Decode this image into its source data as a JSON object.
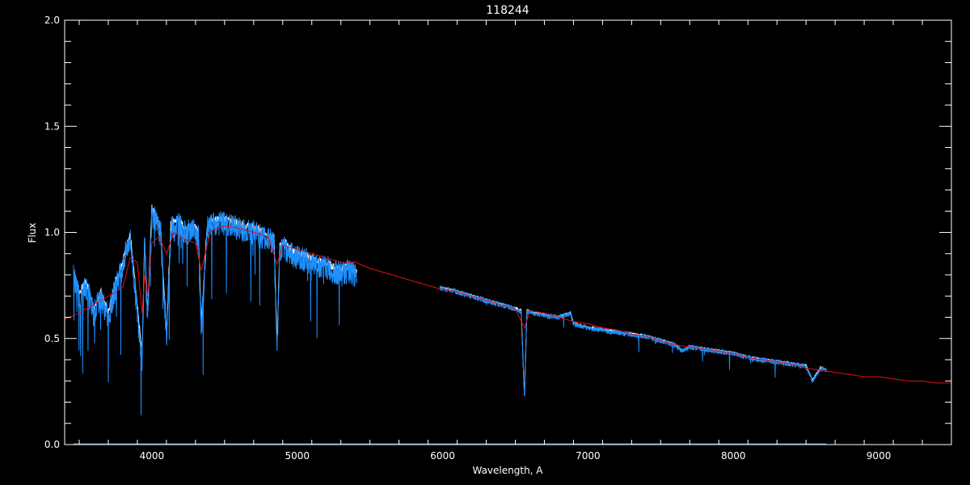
{
  "chart_data": {
    "type": "line",
    "title": "118244",
    "xlabel": "Wavelength, A",
    "ylabel": "Flux",
    "xlim": [
      3400,
      9500
    ],
    "ylim": [
      0.0,
      2.0
    ],
    "x_ticks": [
      4000,
      5000,
      6000,
      7000,
      8000,
      9000
    ],
    "x_tick_labels": [
      "4000",
      "5000",
      "6000",
      "7000",
      "8000",
      "9000"
    ],
    "y_ticks": [
      0.0,
      0.5,
      1.0,
      1.5,
      2.0
    ],
    "y_tick_labels": [
      "0.0",
      "0.5",
      "1.0",
      "1.5",
      "2.0"
    ],
    "grid": false,
    "colors": {
      "background": "#000000",
      "axes": "#ffffff",
      "observed": "#1e90ff",
      "observed_alt": "#ffffff",
      "model": "#e01010"
    },
    "series": [
      {
        "color": "#e01010",
        "x": [
          3400,
          3500,
          3600,
          3700,
          3800,
          3850,
          3900,
          3933,
          3950,
          3970,
          4000,
          4050,
          4101,
          4150,
          4200,
          4250,
          4300,
          4340,
          4400,
          4450,
          4500,
          4600,
          4700,
          4800,
          4861,
          4900,
          5000,
          5100,
          5200,
          5300,
          5400,
          5500,
          5600,
          5700,
          5800,
          5900,
          6000,
          6100,
          6200,
          6300,
          6400,
          6500,
          6563,
          6600,
          6700,
          6800,
          6900,
          7000,
          7100,
          7200,
          7300,
          7400,
          7500,
          7600,
          7700,
          7800,
          7900,
          8000,
          8100,
          8200,
          8300,
          8400,
          8500,
          8600,
          8700,
          8800,
          8900,
          9000,
          9100,
          9200,
          9300,
          9400,
          9500
        ],
        "y": [
          0.59,
          0.62,
          0.66,
          0.7,
          0.74,
          0.88,
          0.86,
          0.62,
          0.8,
          0.7,
          0.95,
          0.98,
          0.9,
          1.0,
          0.98,
          0.96,
          0.95,
          0.82,
          1.0,
          1.02,
          1.03,
          1.02,
          1.0,
          0.98,
          0.85,
          0.94,
          0.92,
          0.9,
          0.88,
          0.86,
          0.86,
          0.83,
          0.81,
          0.79,
          0.77,
          0.75,
          0.73,
          0.72,
          0.7,
          0.68,
          0.66,
          0.64,
          0.55,
          0.63,
          0.62,
          0.6,
          0.58,
          0.57,
          0.55,
          0.54,
          0.52,
          0.51,
          0.49,
          0.47,
          0.46,
          0.45,
          0.44,
          0.43,
          0.41,
          0.4,
          0.39,
          0.38,
          0.36,
          0.35,
          0.34,
          0.33,
          0.32,
          0.32,
          0.31,
          0.3,
          0.3,
          0.29,
          0.29
        ]
      },
      {
        "color": "#1e90ff",
        "x": [
          3460,
          3500,
          3550,
          3600,
          3650,
          3700,
          3750,
          3800,
          3850,
          3890,
          3933,
          3950,
          3970,
          4000,
          4030,
          4060,
          4101,
          4130,
          4180,
          4230,
          4280,
          4320,
          4340,
          4380,
          4420,
          4470,
          4520,
          4570,
          4620,
          4670,
          4720,
          4780,
          4840,
          4861,
          4880,
          4920,
          4960,
          5000,
          5050,
          5100,
          5150,
          5200,
          5250,
          5300,
          5350,
          5410
        ],
        "y": [
          0.8,
          0.7,
          0.75,
          0.62,
          0.7,
          0.6,
          0.75,
          0.85,
          0.98,
          0.7,
          0.4,
          0.95,
          0.6,
          1.1,
          1.05,
          1.0,
          0.5,
          1.02,
          1.05,
          1.0,
          1.02,
          0.98,
          0.55,
          1.02,
          1.04,
          1.05,
          1.04,
          1.03,
          1.02,
          1.01,
          1.0,
          0.98,
          0.96,
          0.45,
          0.92,
          0.93,
          0.9,
          0.89,
          0.88,
          0.86,
          0.85,
          0.84,
          0.82,
          0.81,
          0.82,
          0.8
        ]
      },
      {
        "color": "#1e90ff",
        "x": [
          5980,
          6050,
          6100,
          6150,
          6200,
          6250,
          6300,
          6350,
          6400,
          6450,
          6500,
          6540,
          6563,
          6580,
          6620,
          6700,
          6800,
          6880,
          6900,
          6950,
          7000,
          7100,
          7200,
          7300,
          7400,
          7500,
          7600,
          7650,
          7700,
          7800,
          7900,
          8000,
          8100,
          8200,
          8300,
          8400,
          8500,
          8542,
          8600,
          8640
        ],
        "y": [
          0.74,
          0.73,
          0.72,
          0.71,
          0.7,
          0.69,
          0.68,
          0.67,
          0.66,
          0.65,
          0.64,
          0.63,
          0.22,
          0.63,
          0.62,
          0.61,
          0.6,
          0.62,
          0.57,
          0.56,
          0.55,
          0.54,
          0.53,
          0.52,
          0.51,
          0.49,
          0.47,
          0.44,
          0.46,
          0.45,
          0.44,
          0.43,
          0.41,
          0.4,
          0.39,
          0.38,
          0.37,
          0.3,
          0.36,
          0.35
        ]
      }
    ],
    "baseline": {
      "color": "#1e90ff",
      "y": 0.0,
      "x_range": [
        3460,
        8640
      ]
    }
  }
}
